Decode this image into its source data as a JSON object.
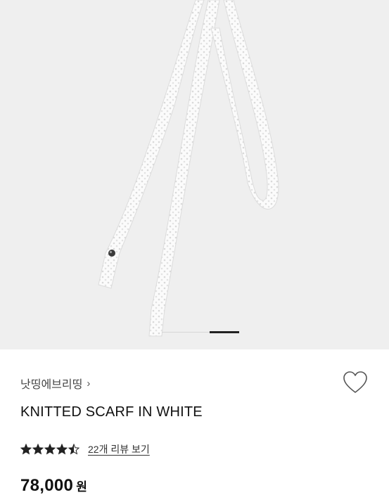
{
  "product": {
    "brand": "낫띵에브리띵",
    "brand_chevron": "›",
    "name": "KNITTED SCARF IN WHITE",
    "rating": {
      "stars": 4.5,
      "reviews_link": "22개 리뷰 보기"
    },
    "price": {
      "amount": "78,000",
      "currency": "원"
    }
  },
  "gallery": {
    "background": "#efefef",
    "pager_total_fraction": 1.0,
    "active_slide_fraction": 0.38
  },
  "icons": {
    "wishlist": "heart-outline-icon",
    "star": "star-filled-icon"
  },
  "colors": {
    "text_primary": "#111111",
    "text_secondary": "#444444",
    "star": "#222222"
  }
}
